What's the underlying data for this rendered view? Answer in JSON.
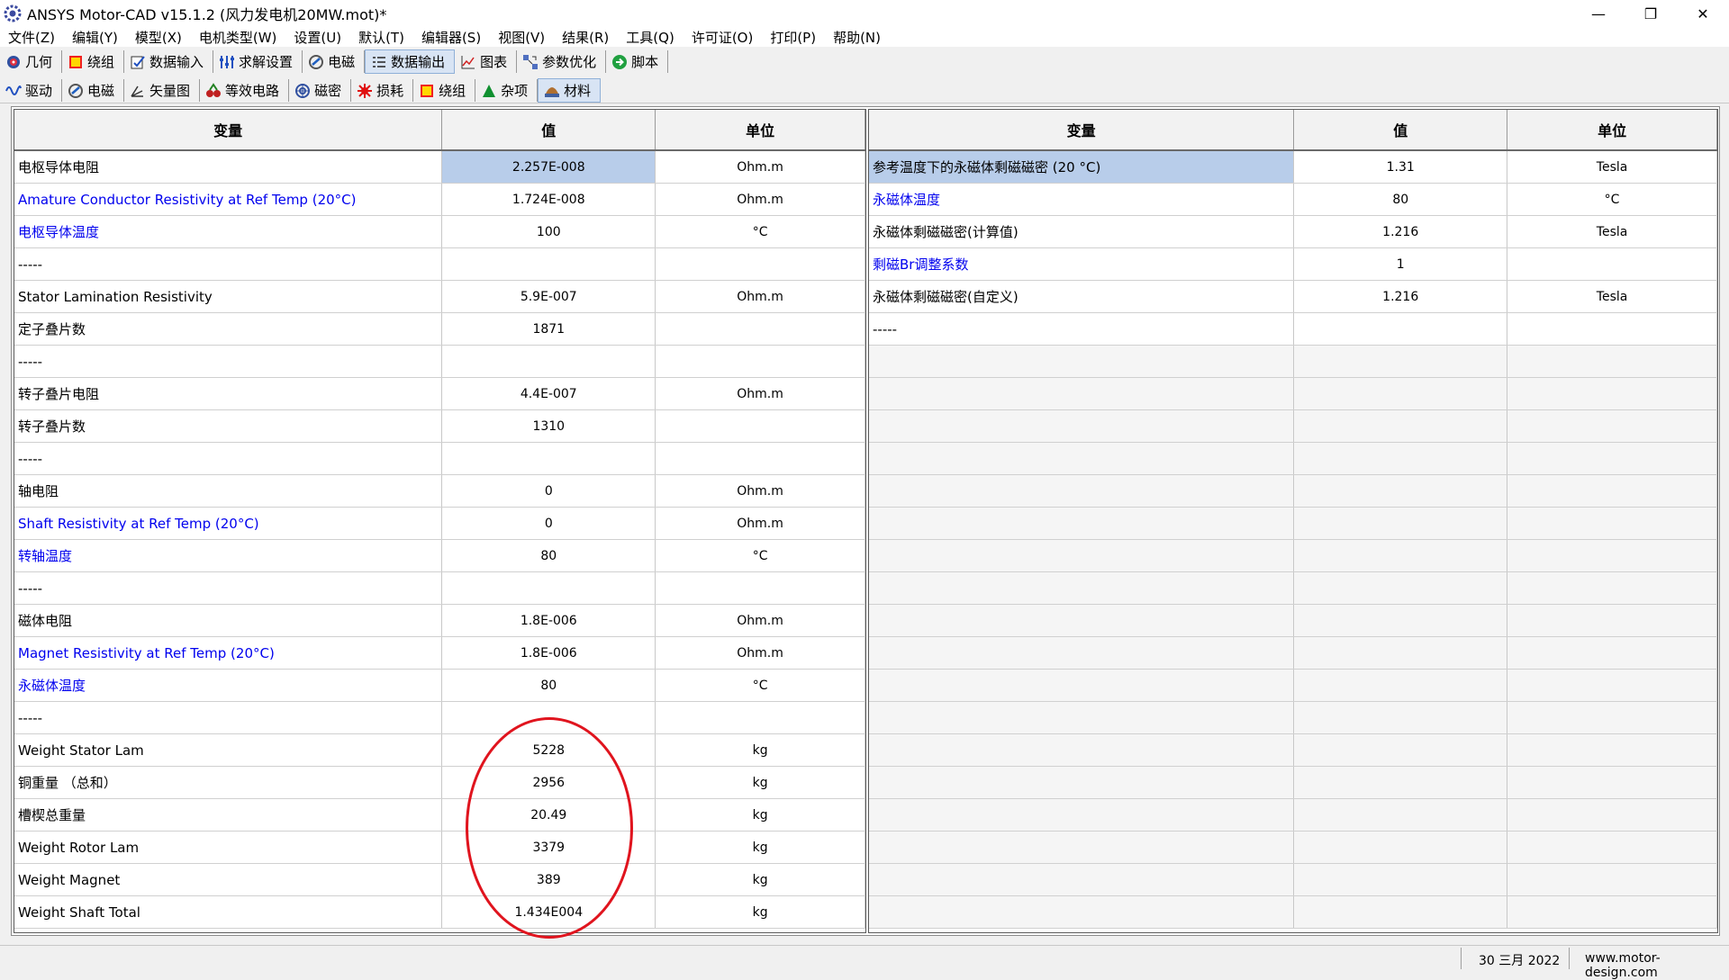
{
  "window": {
    "title": "ANSYS Motor-CAD v15.1.2 (风力发电机20MW.mot)*",
    "minimize": "—",
    "restore": "❐",
    "close": "✕"
  },
  "menu": [
    "文件(Z)",
    "编辑(Y)",
    "模型(X)",
    "电机类型(W)",
    "设置(U)",
    "默认(T)",
    "编辑器(S)",
    "视图(V)",
    "结果(R)",
    "工具(Q)",
    "许可证(O)",
    "打印(P)",
    "帮助(N)"
  ],
  "main_tabs": [
    {
      "label": "几何",
      "icon": "geometry-icon"
    },
    {
      "label": "绕组",
      "icon": "winding-icon"
    },
    {
      "label": "数据输入",
      "icon": "data-input-icon"
    },
    {
      "label": "求解设置",
      "icon": "solver-settings-icon"
    },
    {
      "label": "电磁",
      "icon": "electromagnetic-icon"
    },
    {
      "label": "数据输出",
      "icon": "data-output-icon"
    },
    {
      "label": "图表",
      "icon": "chart-icon"
    },
    {
      "label": "参数优化",
      "icon": "optimization-icon"
    },
    {
      "label": "脚本",
      "icon": "script-icon"
    }
  ],
  "main_active_tab": "数据输出",
  "sub_tabs": [
    {
      "label": "驱动",
      "icon": "drive-icon"
    },
    {
      "label": "电磁",
      "icon": "electromagnetic-icon"
    },
    {
      "label": "矢量图",
      "icon": "vector-diagram-icon"
    },
    {
      "label": "等效电路",
      "icon": "equivalent-circuit-icon"
    },
    {
      "label": "磁密",
      "icon": "flux-density-icon"
    },
    {
      "label": "损耗",
      "icon": "losses-icon"
    },
    {
      "label": "绕组",
      "icon": "winding-icon"
    },
    {
      "label": "杂项",
      "icon": "misc-icon"
    },
    {
      "label": "材料",
      "icon": "materials-icon"
    }
  ],
  "sub_active_tab": "材料",
  "left_table": {
    "headers": [
      "变量",
      "值",
      "单位"
    ],
    "rows": [
      {
        "var": "电枢导体电阻",
        "val": "2.257E-008",
        "unit": "Ohm.m",
        "blue": false,
        "selected": true
      },
      {
        "var": "Amature Conductor Resistivity at Ref Temp (20°C)",
        "val": "1.724E-008",
        "unit": "Ohm.m",
        "blue": true,
        "selected": false
      },
      {
        "var": "电枢导体温度",
        "val": "100",
        "unit": "°C",
        "blue": true,
        "selected": false
      },
      {
        "var": "-----",
        "val": "",
        "unit": "",
        "blue": false,
        "selected": false
      },
      {
        "var": "Stator Lamination Resistivity",
        "val": "5.9E-007",
        "unit": "Ohm.m",
        "blue": false,
        "selected": false
      },
      {
        "var": "定子叠片数",
        "val": "1871",
        "unit": "",
        "blue": false,
        "selected": false
      },
      {
        "var": "-----",
        "val": "",
        "unit": "",
        "blue": false,
        "selected": false
      },
      {
        "var": "转子叠片电阻",
        "val": "4.4E-007",
        "unit": "Ohm.m",
        "blue": false,
        "selected": false
      },
      {
        "var": "转子叠片数",
        "val": "1310",
        "unit": "",
        "blue": false,
        "selected": false
      },
      {
        "var": "-----",
        "val": "",
        "unit": "",
        "blue": false,
        "selected": false
      },
      {
        "var": "轴电阻",
        "val": "0",
        "unit": "Ohm.m",
        "blue": false,
        "selected": false
      },
      {
        "var": "Shaft Resistivity at Ref Temp (20°C)",
        "val": "0",
        "unit": "Ohm.m",
        "blue": true,
        "selected": false
      },
      {
        "var": "转轴温度",
        "val": "80",
        "unit": "°C",
        "blue": true,
        "selected": false
      },
      {
        "var": "-----",
        "val": "",
        "unit": "",
        "blue": false,
        "selected": false
      },
      {
        "var": "磁体电阻",
        "val": "1.8E-006",
        "unit": "Ohm.m",
        "blue": false,
        "selected": false
      },
      {
        "var": "Magnet Resistivity at Ref Temp (20°C)",
        "val": "1.8E-006",
        "unit": "Ohm.m",
        "blue": true,
        "selected": false
      },
      {
        "var": "永磁体温度",
        "val": "80",
        "unit": "°C",
        "blue": true,
        "selected": false
      },
      {
        "var": "-----",
        "val": "",
        "unit": "",
        "blue": false,
        "selected": false
      },
      {
        "var": "Weight Stator Lam",
        "val": "5228",
        "unit": "kg",
        "blue": false,
        "selected": false
      },
      {
        "var": "铜重量 （总和）",
        "val": "2956",
        "unit": "kg",
        "blue": false,
        "selected": false
      },
      {
        "var": "槽楔总重量",
        "val": "20.49",
        "unit": "kg",
        "blue": false,
        "selected": false
      },
      {
        "var": "Weight Rotor Lam",
        "val": "3379",
        "unit": "kg",
        "blue": false,
        "selected": false
      },
      {
        "var": "Weight Magnet",
        "val": "389",
        "unit": "kg",
        "blue": false,
        "selected": false
      },
      {
        "var": "Weight Shaft Total",
        "val": "1.434E004",
        "unit": "kg",
        "blue": false,
        "selected": false
      }
    ]
  },
  "right_table": {
    "headers": [
      "变量",
      "值",
      "单位"
    ],
    "rows": [
      {
        "var": "参考温度下的永磁体剩磁磁密 (20 °C)",
        "val": "1.31",
        "unit": "Tesla",
        "blue": false,
        "selected": true
      },
      {
        "var": "永磁体温度",
        "val": "80",
        "unit": "°C",
        "blue": true,
        "selected": false
      },
      {
        "var": "永磁体剩磁磁密(计算值)",
        "val": "1.216",
        "unit": "Tesla",
        "blue": false,
        "selected": false
      },
      {
        "var": "剩磁Br调整系数",
        "val": "1",
        "unit": "",
        "blue": true,
        "selected": false
      },
      {
        "var": "永磁体剩磁磁密(自定义)",
        "val": "1.216",
        "unit": "Tesla",
        "blue": false,
        "selected": false
      },
      {
        "var": "-----",
        "val": "",
        "unit": "",
        "blue": false,
        "selected": false
      }
    ],
    "empty_rows": 18
  },
  "status": {
    "date": "30 三月 2022",
    "website": "www.motor-design.com"
  },
  "colors": {
    "blue_text": "#0000ee",
    "selected_cell": "#b8cdea",
    "annotation_red": "#e0141e"
  }
}
